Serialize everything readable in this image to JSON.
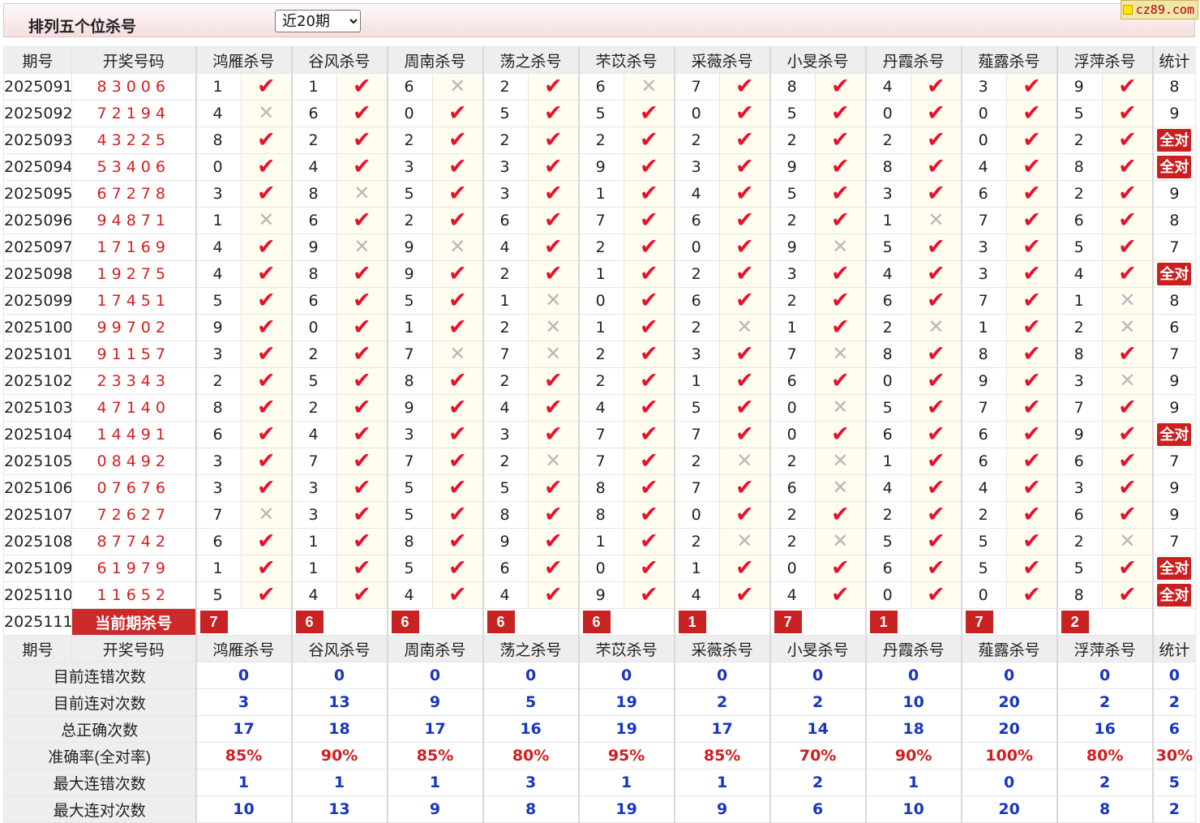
{
  "header": {
    "title": "排列五个位杀号",
    "period_select": "近20期",
    "site": "cz89.com"
  },
  "columns": {
    "period": "期号",
    "draw": "开奖号码",
    "experts": [
      "鸿雁杀号",
      "谷风杀号",
      "周南杀号",
      "荡之杀号",
      "芣苡杀号",
      "采薇杀号",
      "小旻杀号",
      "丹霞杀号",
      "薤露杀号",
      "浮萍杀号"
    ],
    "stats": "统计"
  },
  "all_correct_label": "全对",
  "rows": [
    {
      "period": "2025091",
      "draw": "83006",
      "kills": [
        [
          1,
          1
        ],
        [
          1,
          1
        ],
        [
          6,
          0
        ],
        [
          2,
          1
        ],
        [
          6,
          0
        ],
        [
          7,
          1
        ],
        [
          8,
          1
        ],
        [
          4,
          1
        ],
        [
          3,
          1
        ],
        [
          9,
          1
        ]
      ],
      "stat": "8"
    },
    {
      "period": "2025092",
      "draw": "72194",
      "kills": [
        [
          4,
          0
        ],
        [
          6,
          1
        ],
        [
          0,
          1
        ],
        [
          5,
          1
        ],
        [
          5,
          1
        ],
        [
          0,
          1
        ],
        [
          5,
          1
        ],
        [
          0,
          1
        ],
        [
          0,
          1
        ],
        [
          5,
          1
        ]
      ],
      "stat": "9"
    },
    {
      "period": "2025093",
      "draw": "43225",
      "kills": [
        [
          8,
          1
        ],
        [
          2,
          1
        ],
        [
          2,
          1
        ],
        [
          2,
          1
        ],
        [
          2,
          1
        ],
        [
          2,
          1
        ],
        [
          2,
          1
        ],
        [
          2,
          1
        ],
        [
          0,
          1
        ],
        [
          2,
          1
        ]
      ],
      "stat": "全对"
    },
    {
      "period": "2025094",
      "draw": "53406",
      "kills": [
        [
          0,
          1
        ],
        [
          4,
          1
        ],
        [
          3,
          1
        ],
        [
          3,
          1
        ],
        [
          9,
          1
        ],
        [
          3,
          1
        ],
        [
          9,
          1
        ],
        [
          8,
          1
        ],
        [
          4,
          1
        ],
        [
          8,
          1
        ]
      ],
      "stat": "全对"
    },
    {
      "period": "2025095",
      "draw": "67278",
      "kills": [
        [
          3,
          1
        ],
        [
          8,
          0
        ],
        [
          5,
          1
        ],
        [
          3,
          1
        ],
        [
          1,
          1
        ],
        [
          4,
          1
        ],
        [
          5,
          1
        ],
        [
          3,
          1
        ],
        [
          6,
          1
        ],
        [
          2,
          1
        ]
      ],
      "stat": "9"
    },
    {
      "period": "2025096",
      "draw": "94871",
      "kills": [
        [
          1,
          0
        ],
        [
          6,
          1
        ],
        [
          2,
          1
        ],
        [
          6,
          1
        ],
        [
          7,
          1
        ],
        [
          6,
          1
        ],
        [
          2,
          1
        ],
        [
          1,
          0
        ],
        [
          7,
          1
        ],
        [
          6,
          1
        ]
      ],
      "stat": "8"
    },
    {
      "period": "2025097",
      "draw": "17169",
      "kills": [
        [
          4,
          1
        ],
        [
          9,
          0
        ],
        [
          9,
          0
        ],
        [
          4,
          1
        ],
        [
          2,
          1
        ],
        [
          0,
          1
        ],
        [
          9,
          0
        ],
        [
          5,
          1
        ],
        [
          3,
          1
        ],
        [
          5,
          1
        ]
      ],
      "stat": "7"
    },
    {
      "period": "2025098",
      "draw": "19275",
      "kills": [
        [
          4,
          1
        ],
        [
          8,
          1
        ],
        [
          9,
          1
        ],
        [
          2,
          1
        ],
        [
          1,
          1
        ],
        [
          2,
          1
        ],
        [
          3,
          1
        ],
        [
          4,
          1
        ],
        [
          3,
          1
        ],
        [
          4,
          1
        ]
      ],
      "stat": "全对"
    },
    {
      "period": "2025099",
      "draw": "17451",
      "kills": [
        [
          5,
          1
        ],
        [
          6,
          1
        ],
        [
          5,
          1
        ],
        [
          1,
          0
        ],
        [
          0,
          1
        ],
        [
          6,
          1
        ],
        [
          2,
          1
        ],
        [
          6,
          1
        ],
        [
          7,
          1
        ],
        [
          1,
          0
        ]
      ],
      "stat": "8"
    },
    {
      "period": "2025100",
      "draw": "99702",
      "kills": [
        [
          9,
          1
        ],
        [
          0,
          1
        ],
        [
          1,
          1
        ],
        [
          2,
          0
        ],
        [
          1,
          1
        ],
        [
          2,
          0
        ],
        [
          1,
          1
        ],
        [
          2,
          0
        ],
        [
          1,
          1
        ],
        [
          2,
          0
        ]
      ],
      "stat": "6"
    },
    {
      "period": "2025101",
      "draw": "91157",
      "kills": [
        [
          3,
          1
        ],
        [
          2,
          1
        ],
        [
          7,
          0
        ],
        [
          7,
          0
        ],
        [
          2,
          1
        ],
        [
          3,
          1
        ],
        [
          7,
          0
        ],
        [
          8,
          1
        ],
        [
          8,
          1
        ],
        [
          8,
          1
        ]
      ],
      "stat": "7"
    },
    {
      "period": "2025102",
      "draw": "23343",
      "kills": [
        [
          2,
          1
        ],
        [
          5,
          1
        ],
        [
          8,
          1
        ],
        [
          2,
          1
        ],
        [
          2,
          1
        ],
        [
          1,
          1
        ],
        [
          6,
          1
        ],
        [
          0,
          1
        ],
        [
          9,
          1
        ],
        [
          3,
          0
        ]
      ],
      "stat": "9"
    },
    {
      "period": "2025103",
      "draw": "47140",
      "kills": [
        [
          8,
          1
        ],
        [
          2,
          1
        ],
        [
          9,
          1
        ],
        [
          4,
          1
        ],
        [
          4,
          1
        ],
        [
          5,
          1
        ],
        [
          0,
          0
        ],
        [
          5,
          1
        ],
        [
          7,
          1
        ],
        [
          7,
          1
        ]
      ],
      "stat": "9"
    },
    {
      "period": "2025104",
      "draw": "14491",
      "kills": [
        [
          6,
          1
        ],
        [
          4,
          1
        ],
        [
          3,
          1
        ],
        [
          3,
          1
        ],
        [
          7,
          1
        ],
        [
          7,
          1
        ],
        [
          0,
          1
        ],
        [
          6,
          1
        ],
        [
          6,
          1
        ],
        [
          9,
          1
        ]
      ],
      "stat": "全对"
    },
    {
      "period": "2025105",
      "draw": "08492",
      "kills": [
        [
          3,
          1
        ],
        [
          7,
          1
        ],
        [
          7,
          1
        ],
        [
          2,
          0
        ],
        [
          7,
          1
        ],
        [
          2,
          0
        ],
        [
          2,
          0
        ],
        [
          1,
          1
        ],
        [
          6,
          1
        ],
        [
          6,
          1
        ]
      ],
      "stat": "7"
    },
    {
      "period": "2025106",
      "draw": "07676",
      "kills": [
        [
          3,
          1
        ],
        [
          3,
          1
        ],
        [
          5,
          1
        ],
        [
          5,
          1
        ],
        [
          8,
          1
        ],
        [
          7,
          1
        ],
        [
          6,
          0
        ],
        [
          4,
          1
        ],
        [
          4,
          1
        ],
        [
          3,
          1
        ]
      ],
      "stat": "9"
    },
    {
      "period": "2025107",
      "draw": "72627",
      "kills": [
        [
          7,
          0
        ],
        [
          3,
          1
        ],
        [
          5,
          1
        ],
        [
          8,
          1
        ],
        [
          8,
          1
        ],
        [
          0,
          1
        ],
        [
          2,
          1
        ],
        [
          2,
          1
        ],
        [
          2,
          1
        ],
        [
          6,
          1
        ]
      ],
      "stat": "9"
    },
    {
      "period": "2025108",
      "draw": "87742",
      "kills": [
        [
          6,
          1
        ],
        [
          1,
          1
        ],
        [
          8,
          1
        ],
        [
          9,
          1
        ],
        [
          1,
          1
        ],
        [
          2,
          0
        ],
        [
          2,
          0
        ],
        [
          5,
          1
        ],
        [
          5,
          1
        ],
        [
          2,
          0
        ]
      ],
      "stat": "7"
    },
    {
      "period": "2025109",
      "draw": "61979",
      "kills": [
        [
          1,
          1
        ],
        [
          1,
          1
        ],
        [
          5,
          1
        ],
        [
          6,
          1
        ],
        [
          0,
          1
        ],
        [
          1,
          1
        ],
        [
          0,
          1
        ],
        [
          6,
          1
        ],
        [
          5,
          1
        ],
        [
          5,
          1
        ]
      ],
      "stat": "全对"
    },
    {
      "period": "2025110",
      "draw": "11652",
      "kills": [
        [
          5,
          1
        ],
        [
          4,
          1
        ],
        [
          4,
          1
        ],
        [
          4,
          1
        ],
        [
          9,
          1
        ],
        [
          4,
          1
        ],
        [
          4,
          1
        ],
        [
          0,
          1
        ],
        [
          0,
          1
        ],
        [
          8,
          1
        ]
      ],
      "stat": "全对"
    }
  ],
  "current": {
    "period": "2025111",
    "label": "当前期杀号",
    "kills": [
      "7",
      "6",
      "6",
      "6",
      "6",
      "1",
      "7",
      "1",
      "7",
      "2"
    ]
  },
  "stats_rows": [
    {
      "label": "目前连错次数",
      "values": [
        "0",
        "0",
        "0",
        "0",
        "0",
        "0",
        "0",
        "0",
        "0",
        "0"
      ],
      "total": "0",
      "color": "blue"
    },
    {
      "label": "目前连对次数",
      "values": [
        "3",
        "13",
        "9",
        "5",
        "19",
        "2",
        "2",
        "10",
        "20",
        "2"
      ],
      "total": "2",
      "color": "blue"
    },
    {
      "label": "总正确次数",
      "values": [
        "17",
        "18",
        "17",
        "16",
        "19",
        "17",
        "14",
        "18",
        "20",
        "16"
      ],
      "total": "6",
      "color": "blue"
    },
    {
      "label": "准确率(全对率)",
      "values": [
        "85%",
        "90%",
        "85%",
        "80%",
        "95%",
        "85%",
        "70%",
        "90%",
        "100%",
        "80%"
      ],
      "total": "30%",
      "color": "red"
    },
    {
      "label": "最大连错次数",
      "values": [
        "1",
        "1",
        "1",
        "3",
        "1",
        "1",
        "2",
        "1",
        "0",
        "2"
      ],
      "total": "5",
      "color": "blue"
    },
    {
      "label": "最大连对次数",
      "values": [
        "10",
        "13",
        "9",
        "8",
        "19",
        "9",
        "6",
        "10",
        "20",
        "8"
      ],
      "total": "2",
      "color": "blue"
    }
  ],
  "colors": {
    "check": "#e8112d",
    "cross": "#b8b8b8",
    "badge": "#cc1f1f",
    "stat_blue": "#1a35c0",
    "stat_red": "#d41c1c"
  }
}
